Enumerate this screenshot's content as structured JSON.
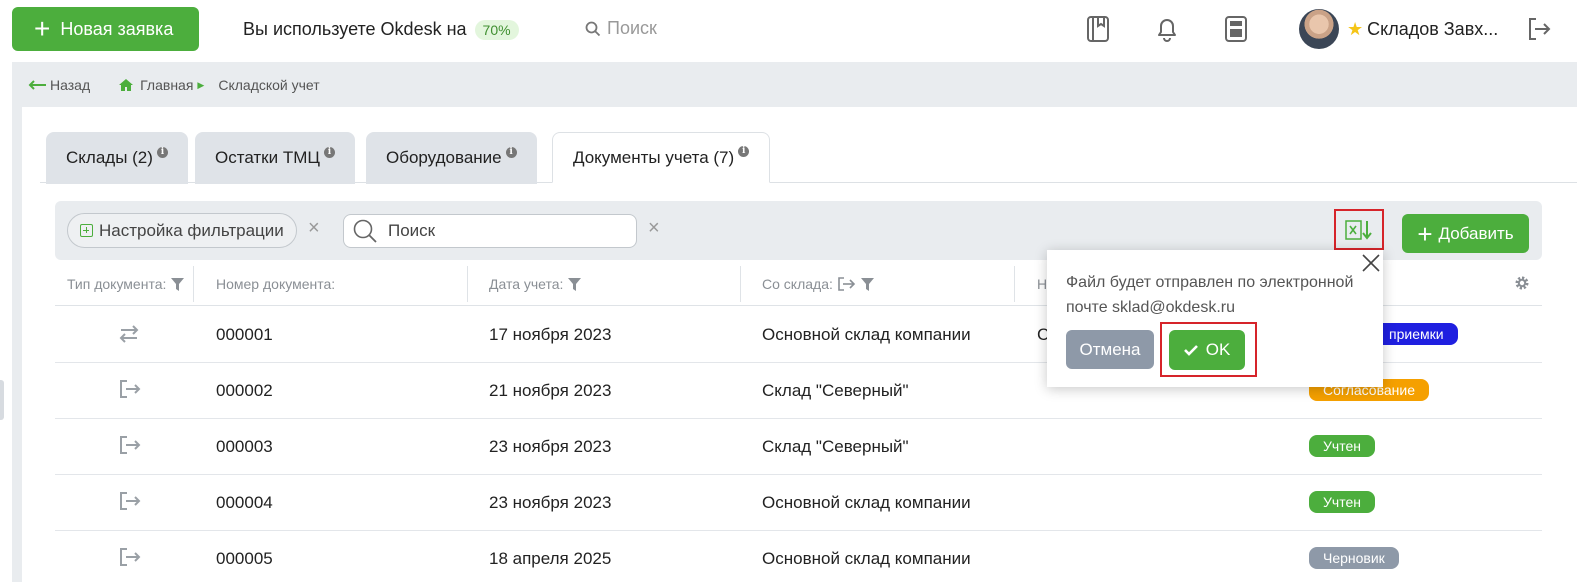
{
  "header": {
    "new_button": "Новая заявка",
    "usage_text": "Вы используете Okdesk на",
    "usage_pct": "70%",
    "search_placeholder": "Поиск",
    "user_name": "Складов Завх..."
  },
  "breadcrumb": {
    "back": "Назад",
    "home": "Главная",
    "current": "Складской учет"
  },
  "tabs": [
    {
      "label": "Склады (2)"
    },
    {
      "label": "Остатки ТМЦ"
    },
    {
      "label": "Оборудование"
    },
    {
      "label": "Документы учета (7)"
    }
  ],
  "toolbar": {
    "filter_label": "Настройка фильтрации",
    "search_placeholder": "Поиск",
    "add_label": "Добавить"
  },
  "table": {
    "columns": [
      "Тип документа:",
      "Номер документа:",
      "Дата учета:",
      "Со склада:",
      "Н"
    ],
    "rows": [
      {
        "type_icon": "transfer-icon",
        "number": "000001",
        "date": "17 ноября 2023",
        "from": "Основной склад компании",
        "to": "С",
        "status": "приемки",
        "status_color": "#1f1fe0"
      },
      {
        "type_icon": "outgoing-icon",
        "number": "000002",
        "date": "21 ноября 2023",
        "from": "Склад \"Северный\"",
        "to": "",
        "status": "Согласование",
        "status_color": "#f5a000"
      },
      {
        "type_icon": "outgoing-icon",
        "number": "000003",
        "date": "23 ноября 2023",
        "from": "Склад \"Северный\"",
        "to": "",
        "status": "Учтен",
        "status_color": "#4cae3d"
      },
      {
        "type_icon": "outgoing-icon",
        "number": "000004",
        "date": "23 ноября 2023",
        "from": "Основной склад компании",
        "to": "",
        "status": "Учтен",
        "status_color": "#4cae3d"
      },
      {
        "type_icon": "outgoing-icon",
        "number": "000005",
        "date": "18 апреля 2025",
        "from": "Основной склад компании",
        "to": "",
        "status": "Черновик",
        "status_color": "#8e99a8"
      }
    ]
  },
  "popup": {
    "message": "Файл будет отправлен по электронной почте sklad@okdesk.ru",
    "cancel": "Отмена",
    "ok": "OK"
  },
  "colors": {
    "accent": "#4cae3d",
    "highlight": "#d6242a"
  }
}
